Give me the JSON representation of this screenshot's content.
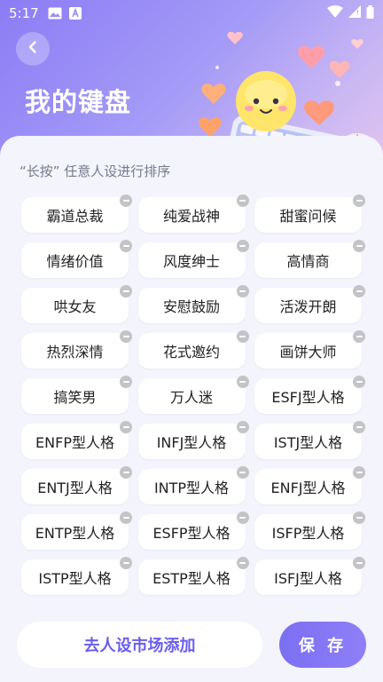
{
  "status_bar": {
    "time": "5:17"
  },
  "header": {
    "title": "我的键盘"
  },
  "hint": "“长按” 任意人设进行排序",
  "personas": [
    "霸道总裁",
    "纯爱战神",
    "甜蜜问候",
    "情绪价值",
    "风度绅士",
    "高情商",
    "哄女友",
    "安慰鼓励",
    "活泼开朗",
    "热烈深情",
    "花式邀约",
    "画饼大师",
    "搞笑男",
    "万人迷",
    "ESFJ型人格",
    "ENFP型人格",
    "INFJ型人格",
    "ISTJ型人格",
    "ENTJ型人格",
    "INTP型人格",
    "ENFJ型人格",
    "ENTP型人格",
    "ESFP型人格",
    "ISFP型人格",
    "ISTP型人格",
    "ESTP型人格",
    "ISFJ型人格"
  ],
  "footer": {
    "add_label": "去人设市场添加",
    "save_label": "保 存"
  },
  "colors": {
    "accent": "#7b6ff2",
    "hero_start": "#8c7cf5",
    "hero_end": "#e9c9ec"
  }
}
